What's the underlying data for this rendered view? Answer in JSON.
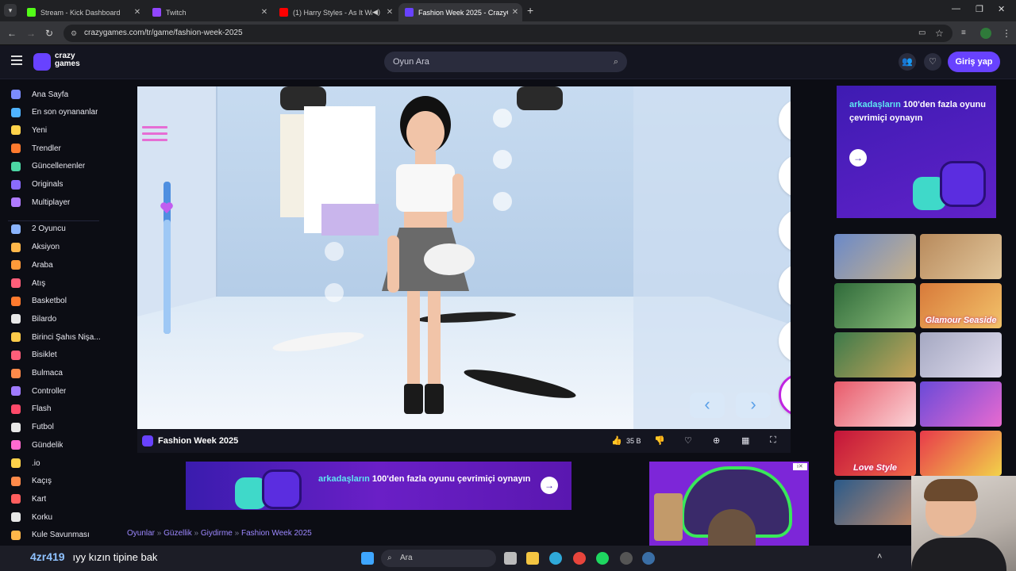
{
  "browser": {
    "tabs": [
      {
        "label": "Stream - Kick Dashboard",
        "icon_color": "#53fc18"
      },
      {
        "label": "Twitch",
        "icon_color": "#9146ff"
      },
      {
        "label": "(1) Harry Styles - As It Was (",
        "icon_color": "#ff0000"
      },
      {
        "label": "Fashion Week 2025 - CrazyGa",
        "icon_color": "#6842ff"
      }
    ],
    "url": "crazygames.com/tr/game/fashion-week-2025"
  },
  "header": {
    "logo_line1": "crazy",
    "logo_line2": "games",
    "search_placeholder": "Oyun Ara",
    "login_label": "Giriş yap"
  },
  "sidebar": {
    "items": [
      {
        "label": "Ana Sayfa",
        "color": "#7b8cff"
      },
      {
        "label": "En son oynananlar",
        "color": "#4fb3ff"
      },
      {
        "label": "Yeni",
        "color": "#ffd24a"
      },
      {
        "label": "Trendler",
        "color": "#ff7a2e"
      },
      {
        "label": "Güncellenenler",
        "color": "#4cd6a4"
      },
      {
        "label": "Originals",
        "color": "#8a6bff"
      },
      {
        "label": "Multiplayer",
        "color": "#b07bff"
      },
      {
        "label": "2 Oyuncu",
        "color": "#8ab4ff"
      },
      {
        "label": "Aksiyon",
        "color": "#ffb74a"
      },
      {
        "label": "Araba",
        "color": "#ff9a3a"
      },
      {
        "label": "Atış",
        "color": "#ff5e7a"
      },
      {
        "label": "Basketbol",
        "color": "#ff7a2e"
      },
      {
        "label": "Bilardo",
        "color": "#e8e8e8"
      },
      {
        "label": "Birinci Şahıs Nişa...",
        "color": "#ffcc4a"
      },
      {
        "label": "Bisiklet",
        "color": "#ff5e7a"
      },
      {
        "label": "Bulmaca",
        "color": "#ff8a4a"
      },
      {
        "label": "Controller",
        "color": "#a07bff"
      },
      {
        "label": "Flash",
        "color": "#ff4a6a"
      },
      {
        "label": "Futbol",
        "color": "#e8e8e8"
      },
      {
        "label": "Gündelik",
        "color": "#ff6ad0"
      },
      {
        "label": ".io",
        "color": "#ffd24a"
      },
      {
        "label": "Kaçış",
        "color": "#ff8a4a"
      },
      {
        "label": "Kart",
        "color": "#ff5e5e"
      },
      {
        "label": "Korku",
        "color": "#e8e8e8"
      },
      {
        "label": "Kule Savunması",
        "color": "#ffb74a"
      }
    ]
  },
  "game": {
    "title": "Fashion Week 2025",
    "likes": "35 B"
  },
  "banners": {
    "mid_prefix": "arkadaşların",
    "mid_highlight": "100",
    "mid_rest": "'den fazla oyunu çevrimiçi oynayın",
    "right_prefix": "arkadaşların",
    "right_highlight": "100",
    "right_rest": "'den fazla oyunu çevrimiçi oynayın"
  },
  "thumbnails": [
    {
      "label": "",
      "color1": "#6a89c9",
      "color2": "#c9b28a"
    },
    {
      "label": "",
      "color1": "#b88a5c",
      "color2": "#e2c79c"
    },
    {
      "label": "",
      "color1": "#2f6a3a",
      "color2": "#8bbd7a"
    },
    {
      "label": "Glamour Seaside",
      "color1": "#d87a3a",
      "color2": "#f2c26a"
    },
    {
      "label": "",
      "color1": "#3c7a4a",
      "color2": "#c8a45a"
    },
    {
      "label": "",
      "color1": "#a5a8c2",
      "color2": "#e0ddee"
    },
    {
      "label": "",
      "color1": "#e85a6a",
      "color2": "#fbd4d8"
    },
    {
      "label": "",
      "color1": "#6a4ad8",
      "color2": "#e86ad0"
    },
    {
      "label": "Love Style",
      "color1": "#c2143a",
      "color2": "#f26a4a"
    },
    {
      "label": "",
      "color1": "#e83a4a",
      "color2": "#f2d24a"
    },
    {
      "label": "",
      "color1": "#2a5a8a",
      "color2": "#c28a6a"
    },
    {
      "label": "",
      "color1": "#3a2a6a",
      "color2": "#c24a8a"
    }
  ],
  "breadcrumb": [
    "Oyunlar",
    "Güzellik",
    "Giydirme",
    "Fashion Week 2025"
  ],
  "taskbar": {
    "chat_user": "4zr419",
    "chat_message": "ıyy kızın tipine bak",
    "search_placeholder": "Ara"
  }
}
